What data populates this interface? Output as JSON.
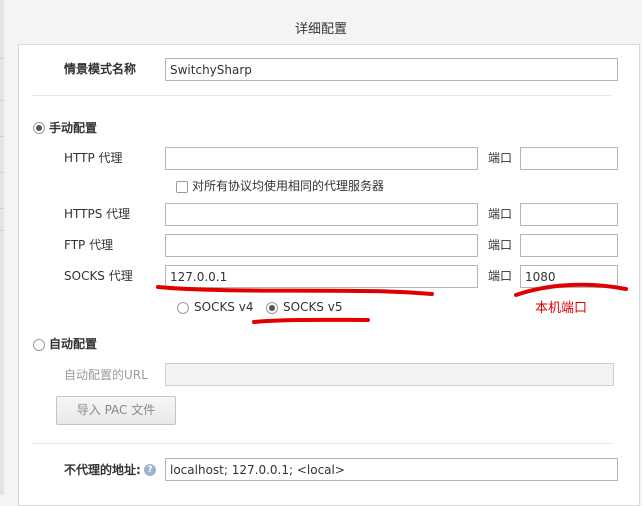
{
  "dialog": {
    "title": "详细配置"
  },
  "profile": {
    "label": "情景模式名称",
    "value": "SwitchySharp"
  },
  "manual": {
    "label": "手动配置",
    "port_label": "端口",
    "http": {
      "label": "HTTP 代理",
      "host": "",
      "port": ""
    },
    "same_proxy": {
      "label": "对所有协议均使用相同的代理服务器"
    },
    "https": {
      "label": "HTTPS 代理",
      "host": "",
      "port": ""
    },
    "ftp": {
      "label": "FTP 代理",
      "host": "",
      "port": ""
    },
    "socks": {
      "label": "SOCKS 代理",
      "host": "127.0.0.1",
      "port": "1080"
    },
    "socks_v4": "SOCKS v4",
    "socks_v5": "SOCKS v5"
  },
  "auto": {
    "label": "自动配置",
    "url_label": "自动配置的URL",
    "url_value": "",
    "import_pac": "导入 PAC 文件"
  },
  "bypass": {
    "label": "不代理的地址:",
    "value": "localhost; 127.0.0.1; <local>"
  },
  "annotation": {
    "text": "本机端口",
    "color": "#e00000"
  },
  "help_icon_glyph": "?"
}
